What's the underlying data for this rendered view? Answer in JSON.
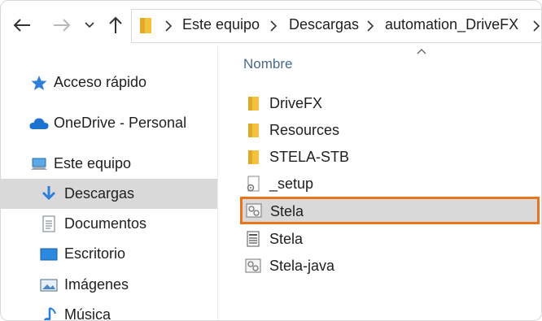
{
  "address_bar": {
    "crumbs": [
      "Este equipo",
      "Descargas",
      "automation_DriveFX"
    ]
  },
  "sidebar": {
    "items": [
      {
        "label": "Acceso rápido",
        "icon": "star-icon"
      },
      {
        "label": "OneDrive - Personal",
        "icon": "cloud-icon"
      },
      {
        "label": "Este equipo",
        "icon": "computer-icon"
      },
      {
        "label": "Descargas",
        "icon": "download-arrow-icon",
        "selected": true
      },
      {
        "label": "Documentos",
        "icon": "document-icon"
      },
      {
        "label": "Escritorio",
        "icon": "desktop-icon"
      },
      {
        "label": "Imágenes",
        "icon": "image-icon"
      },
      {
        "label": "Música",
        "icon": "music-note-icon"
      }
    ]
  },
  "file_list": {
    "column_header": "Nombre",
    "items": [
      {
        "name": "DriveFX",
        "type": "folder"
      },
      {
        "name": "Resources",
        "type": "folder"
      },
      {
        "name": "STELA-STB",
        "type": "folder"
      },
      {
        "name": "_setup",
        "type": "settings-file"
      },
      {
        "name": "Stela",
        "type": "batch-file",
        "highlighted": true
      },
      {
        "name": "Stela",
        "type": "text-file"
      },
      {
        "name": "Stela-java",
        "type": "batch-file"
      }
    ]
  },
  "colors": {
    "highlight_border": "#e8751a",
    "selected_background": "#d9d9d9",
    "folder": "#f5c33b",
    "header_text": "#4a6a89"
  }
}
